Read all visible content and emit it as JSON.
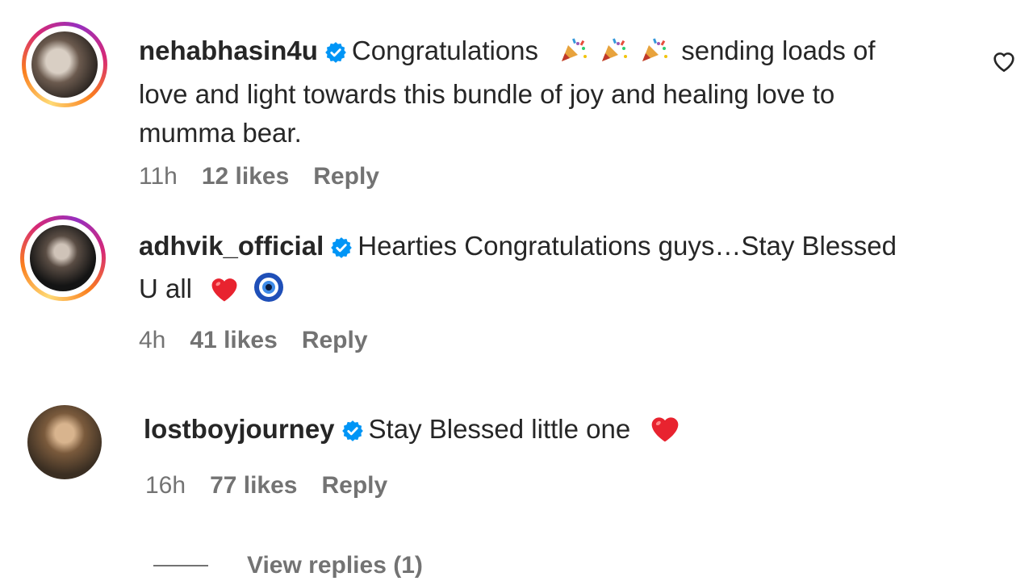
{
  "comments": [
    {
      "username": "nehabhasin4u",
      "text_lines": [
        "sending loads of",
        "love and light towards this bundle of joy and healing love to",
        "mumma bear."
      ],
      "lead": "Congratulations",
      "time": "11h",
      "likes": "12 likes",
      "reply": "Reply"
    },
    {
      "username": "adhvik_official",
      "text_lines": [
        "Hearties Congratulations guys…Stay Blessed",
        "U all"
      ],
      "time": "4h",
      "likes": "41 likes",
      "reply": "Reply"
    },
    {
      "username": "lostboyjourney",
      "text_lines": [
        "Stay Blessed little one"
      ],
      "time": "16h",
      "likes": "77 likes",
      "reply": "Reply"
    }
  ],
  "view_replies": "View replies (1)",
  "icons": {
    "verified": "verified-badge-icon",
    "like": "heart-outline-icon",
    "party": "party-popper-emoji",
    "red_heart": "red-heart-emoji",
    "evil_eye": "nazar-amulet-emoji"
  },
  "colors": {
    "verified_blue": "#0095f6",
    "meta_gray": "#737373",
    "text": "#262626"
  }
}
